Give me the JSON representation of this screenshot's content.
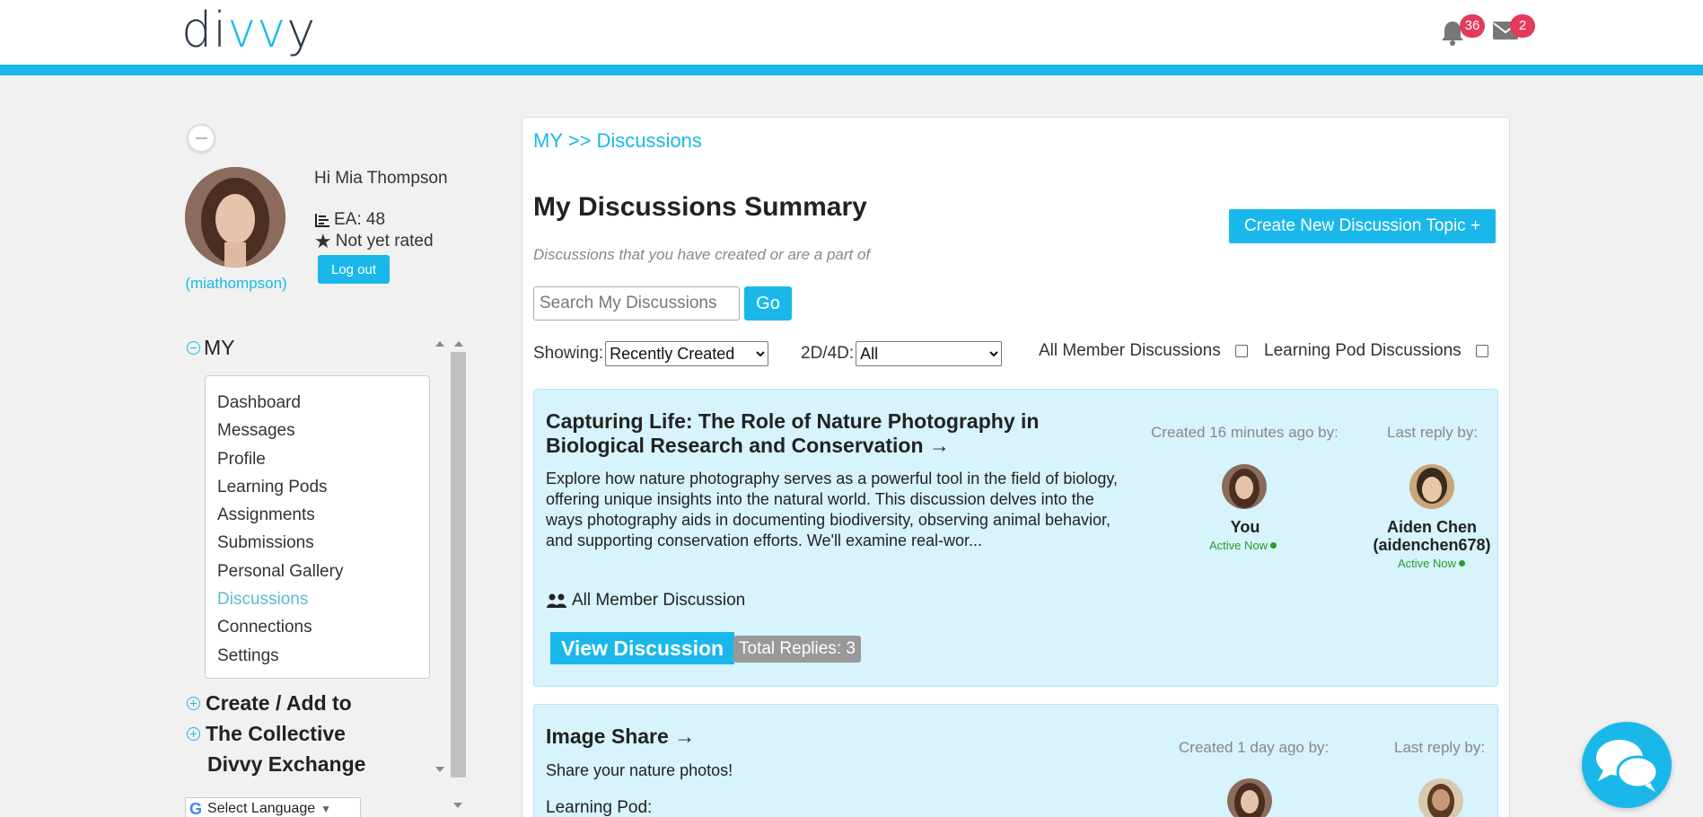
{
  "header": {
    "logo": "divvy",
    "notifications_count": "36",
    "messages_count": "2"
  },
  "profile": {
    "greeting": "Hi Mia Thompson",
    "ea": "EA: 48",
    "rating": "Not yet rated",
    "logout_label": "Log out",
    "username": "(miathompson)"
  },
  "nav": {
    "section_title": "MY",
    "items": [
      {
        "label": "Dashboard"
      },
      {
        "label": "Messages"
      },
      {
        "label": "Profile"
      },
      {
        "label": "Learning Pods"
      },
      {
        "label": "Assignments"
      },
      {
        "label": "Submissions"
      },
      {
        "label": "Personal Gallery"
      },
      {
        "label": "Discussions",
        "active": true
      },
      {
        "label": "Connections"
      },
      {
        "label": "Settings"
      }
    ],
    "other_sections": [
      "Create / Add to",
      "The Collective",
      "Divvy Exchange"
    ],
    "language_label": "Select Language"
  },
  "main": {
    "breadcrumb": "MY >> Discussions",
    "title": "My Discussions Summary",
    "subtitle": "Discussions that you have created or are a part of",
    "create_button": "Create New Discussion Topic +",
    "search_placeholder": "Search My Discussions",
    "go_label": "Go",
    "showing_label": "Showing:",
    "showing_value": "Recently Created",
    "dim_label": "2D/4D:",
    "dim_value": "All",
    "all_member_label": "All Member Discussions",
    "pod_label": "Learning Pod Discussions"
  },
  "discussions": [
    {
      "title_line1": "Capturing Life: The Role of Nature Photography in",
      "title_line2": "Biological Research and Conservation",
      "description": "Explore how nature photography serves as a powerful tool in the field of biology, offering unique insights into the natural world. This discussion delves into the ways photography aids in documenting biodiversity, observing animal behavior, and supporting conservation efforts. We'll examine real-wor...",
      "type": "All Member Discussion",
      "view_label": "View Discussion",
      "replies": "Total Replies: 3",
      "created_label": "Created 16 minutes ago by:",
      "last_reply_label": "Last reply by:",
      "creator": "You",
      "creator_status": "Active Now",
      "last_reply_name": "Aiden Chen",
      "last_reply_user": "(aidenchen678)",
      "last_reply_status": "Active Now"
    },
    {
      "title_line1": "Image Share",
      "description": "Share your nature photos!",
      "type": "Learning Pod:",
      "created_label": "Created 1 day ago by:",
      "last_reply_label": "Last reply by:"
    }
  ],
  "colors": {
    "accent": "#1ab8ea",
    "card_bg": "#d7f3fb",
    "badge": "#e33b5a"
  }
}
